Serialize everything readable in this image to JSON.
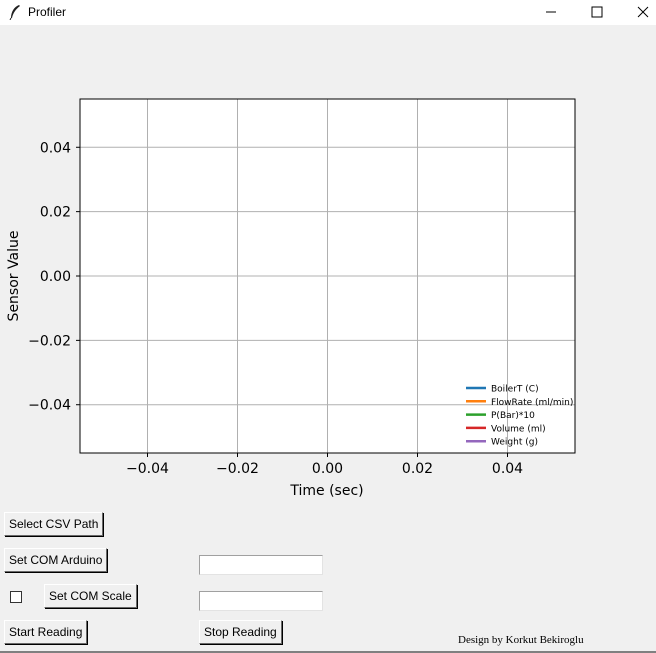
{
  "window": {
    "title": "Profiler",
    "icon": "feather-icon"
  },
  "chart_data": {
    "type": "line",
    "title": "",
    "xlabel": "Time (sec)",
    "ylabel": "Sensor Value",
    "xlim": [
      -0.055,
      0.055
    ],
    "ylim": [
      -0.055,
      0.055
    ],
    "xticks": [
      -0.04,
      -0.02,
      0.0,
      0.02,
      0.04
    ],
    "xtick_labels": [
      "−0.04",
      "−0.02",
      "0.00",
      "0.02",
      "0.04"
    ],
    "yticks": [
      0.04,
      0.02,
      0.0,
      -0.02,
      -0.04
    ],
    "ytick_labels": [
      "0.04",
      "0.02",
      "0.00",
      "−0.02",
      "−0.04"
    ],
    "grid": true,
    "legend_position": "lower-right",
    "series": [
      {
        "name": "BoilerT (C)",
        "color": "#1f77b4",
        "x": [],
        "y": []
      },
      {
        "name": "FlowRate (ml/min)",
        "color": "#ff7f0e",
        "x": [],
        "y": []
      },
      {
        "name": "P(Bar)*10",
        "color": "#2ca02c",
        "x": [],
        "y": []
      },
      {
        "name": "Volume (ml)",
        "color": "#d62728",
        "x": [],
        "y": []
      },
      {
        "name": "Weight (g)",
        "color": "#9467bd",
        "x": [],
        "y": []
      }
    ]
  },
  "controls": {
    "select_csv_label": "Select CSV Path",
    "set_com_arduino_label": "Set COM Arduino",
    "arduino_port_value": "",
    "scale_checkbox_checked": false,
    "set_com_scale_label": "Set COM Scale",
    "scale_port_value": "",
    "start_label": "Start Reading",
    "stop_label": "Stop Reading"
  },
  "credit": "Design by Korkut Bekiroglu"
}
